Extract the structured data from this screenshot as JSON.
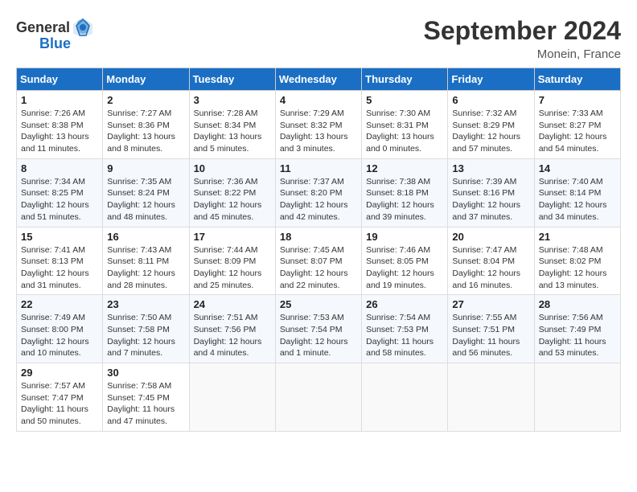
{
  "header": {
    "logo_general": "General",
    "logo_blue": "Blue",
    "month": "September 2024",
    "location": "Monein, France"
  },
  "weekdays": [
    "Sunday",
    "Monday",
    "Tuesday",
    "Wednesday",
    "Thursday",
    "Friday",
    "Saturday"
  ],
  "days": [
    {
      "num": "",
      "info": ""
    },
    {
      "num": "",
      "info": ""
    },
    {
      "num": "",
      "info": ""
    },
    {
      "num": "",
      "info": ""
    },
    {
      "num": "",
      "info": ""
    },
    {
      "num": "",
      "info": ""
    },
    {
      "num": "1",
      "sunrise": "Sunrise: 7:26 AM",
      "sunset": "Sunset: 8:38 PM",
      "daylight": "Daylight: 13 hours and 11 minutes."
    },
    {
      "num": "2",
      "sunrise": "Sunrise: 7:27 AM",
      "sunset": "Sunset: 8:36 PM",
      "daylight": "Daylight: 13 hours and 8 minutes."
    },
    {
      "num": "3",
      "sunrise": "Sunrise: 7:28 AM",
      "sunset": "Sunset: 8:34 PM",
      "daylight": "Daylight: 13 hours and 5 minutes."
    },
    {
      "num": "4",
      "sunrise": "Sunrise: 7:29 AM",
      "sunset": "Sunset: 8:32 PM",
      "daylight": "Daylight: 13 hours and 3 minutes."
    },
    {
      "num": "5",
      "sunrise": "Sunrise: 7:30 AM",
      "sunset": "Sunset: 8:31 PM",
      "daylight": "Daylight: 13 hours and 0 minutes."
    },
    {
      "num": "6",
      "sunrise": "Sunrise: 7:32 AM",
      "sunset": "Sunset: 8:29 PM",
      "daylight": "Daylight: 12 hours and 57 minutes."
    },
    {
      "num": "7",
      "sunrise": "Sunrise: 7:33 AM",
      "sunset": "Sunset: 8:27 PM",
      "daylight": "Daylight: 12 hours and 54 minutes."
    },
    {
      "num": "8",
      "sunrise": "Sunrise: 7:34 AM",
      "sunset": "Sunset: 8:25 PM",
      "daylight": "Daylight: 12 hours and 51 minutes."
    },
    {
      "num": "9",
      "sunrise": "Sunrise: 7:35 AM",
      "sunset": "Sunset: 8:24 PM",
      "daylight": "Daylight: 12 hours and 48 minutes."
    },
    {
      "num": "10",
      "sunrise": "Sunrise: 7:36 AM",
      "sunset": "Sunset: 8:22 PM",
      "daylight": "Daylight: 12 hours and 45 minutes."
    },
    {
      "num": "11",
      "sunrise": "Sunrise: 7:37 AM",
      "sunset": "Sunset: 8:20 PM",
      "daylight": "Daylight: 12 hours and 42 minutes."
    },
    {
      "num": "12",
      "sunrise": "Sunrise: 7:38 AM",
      "sunset": "Sunset: 8:18 PM",
      "daylight": "Daylight: 12 hours and 39 minutes."
    },
    {
      "num": "13",
      "sunrise": "Sunrise: 7:39 AM",
      "sunset": "Sunset: 8:16 PM",
      "daylight": "Daylight: 12 hours and 37 minutes."
    },
    {
      "num": "14",
      "sunrise": "Sunrise: 7:40 AM",
      "sunset": "Sunset: 8:14 PM",
      "daylight": "Daylight: 12 hours and 34 minutes."
    },
    {
      "num": "15",
      "sunrise": "Sunrise: 7:41 AM",
      "sunset": "Sunset: 8:13 PM",
      "daylight": "Daylight: 12 hours and 31 minutes."
    },
    {
      "num": "16",
      "sunrise": "Sunrise: 7:43 AM",
      "sunset": "Sunset: 8:11 PM",
      "daylight": "Daylight: 12 hours and 28 minutes."
    },
    {
      "num": "17",
      "sunrise": "Sunrise: 7:44 AM",
      "sunset": "Sunset: 8:09 PM",
      "daylight": "Daylight: 12 hours and 25 minutes."
    },
    {
      "num": "18",
      "sunrise": "Sunrise: 7:45 AM",
      "sunset": "Sunset: 8:07 PM",
      "daylight": "Daylight: 12 hours and 22 minutes."
    },
    {
      "num": "19",
      "sunrise": "Sunrise: 7:46 AM",
      "sunset": "Sunset: 8:05 PM",
      "daylight": "Daylight: 12 hours and 19 minutes."
    },
    {
      "num": "20",
      "sunrise": "Sunrise: 7:47 AM",
      "sunset": "Sunset: 8:04 PM",
      "daylight": "Daylight: 12 hours and 16 minutes."
    },
    {
      "num": "21",
      "sunrise": "Sunrise: 7:48 AM",
      "sunset": "Sunset: 8:02 PM",
      "daylight": "Daylight: 12 hours and 13 minutes."
    },
    {
      "num": "22",
      "sunrise": "Sunrise: 7:49 AM",
      "sunset": "Sunset: 8:00 PM",
      "daylight": "Daylight: 12 hours and 10 minutes."
    },
    {
      "num": "23",
      "sunrise": "Sunrise: 7:50 AM",
      "sunset": "Sunset: 7:58 PM",
      "daylight": "Daylight: 12 hours and 7 minutes."
    },
    {
      "num": "24",
      "sunrise": "Sunrise: 7:51 AM",
      "sunset": "Sunset: 7:56 PM",
      "daylight": "Daylight: 12 hours and 4 minutes."
    },
    {
      "num": "25",
      "sunrise": "Sunrise: 7:53 AM",
      "sunset": "Sunset: 7:54 PM",
      "daylight": "Daylight: 12 hours and 1 minute."
    },
    {
      "num": "26",
      "sunrise": "Sunrise: 7:54 AM",
      "sunset": "Sunset: 7:53 PM",
      "daylight": "Daylight: 11 hours and 58 minutes."
    },
    {
      "num": "27",
      "sunrise": "Sunrise: 7:55 AM",
      "sunset": "Sunset: 7:51 PM",
      "daylight": "Daylight: 11 hours and 56 minutes."
    },
    {
      "num": "28",
      "sunrise": "Sunrise: 7:56 AM",
      "sunset": "Sunset: 7:49 PM",
      "daylight": "Daylight: 11 hours and 53 minutes."
    },
    {
      "num": "29",
      "sunrise": "Sunrise: 7:57 AM",
      "sunset": "Sunset: 7:47 PM",
      "daylight": "Daylight: 11 hours and 50 minutes."
    },
    {
      "num": "30",
      "sunrise": "Sunrise: 7:58 AM",
      "sunset": "Sunset: 7:45 PM",
      "daylight": "Daylight: 11 hours and 47 minutes."
    },
    {
      "num": "",
      "info": ""
    },
    {
      "num": "",
      "info": ""
    },
    {
      "num": "",
      "info": ""
    },
    {
      "num": "",
      "info": ""
    },
    {
      "num": "",
      "info": ""
    }
  ]
}
